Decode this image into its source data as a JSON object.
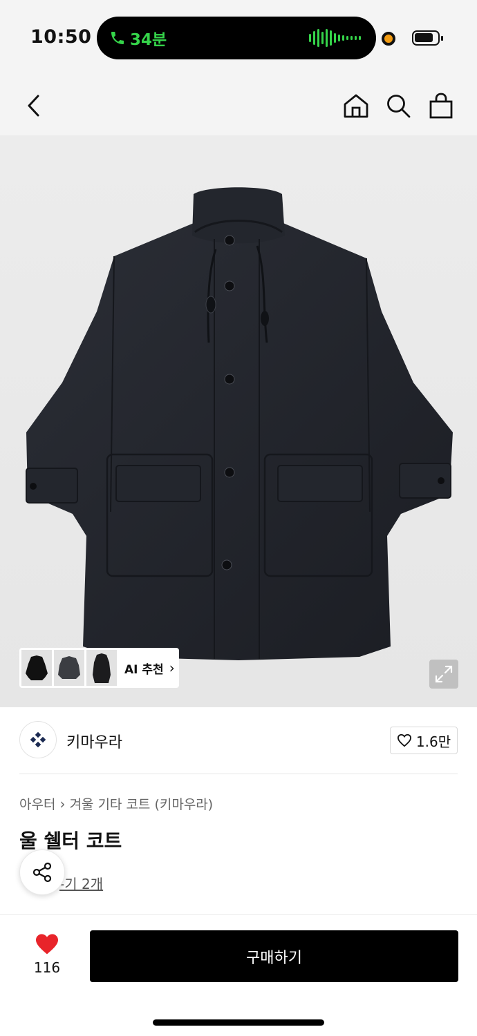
{
  "status_bar": {
    "time": "10:50",
    "call_duration": "34분",
    "call_color": "#35d44a"
  },
  "nav": {
    "icons": [
      "back-icon",
      "home-icon",
      "search-icon",
      "shopping-bag-icon"
    ]
  },
  "image_overlay": {
    "ai_label": "AI 추천",
    "ai_chevron": "›"
  },
  "brand": {
    "name": "키마우라",
    "likes": "1.6만"
  },
  "product": {
    "breadcrumb_category": "아우터",
    "breadcrumb_separator": "›",
    "breadcrumb_subcategory": "겨울 기타 코트 (키마우라)",
    "title": "울 쉘터 코트",
    "review_link": "-기 2개"
  },
  "bottom_bar": {
    "wish_count": "116",
    "buy_label": "구매하기",
    "heart_color": "#e8242a"
  }
}
